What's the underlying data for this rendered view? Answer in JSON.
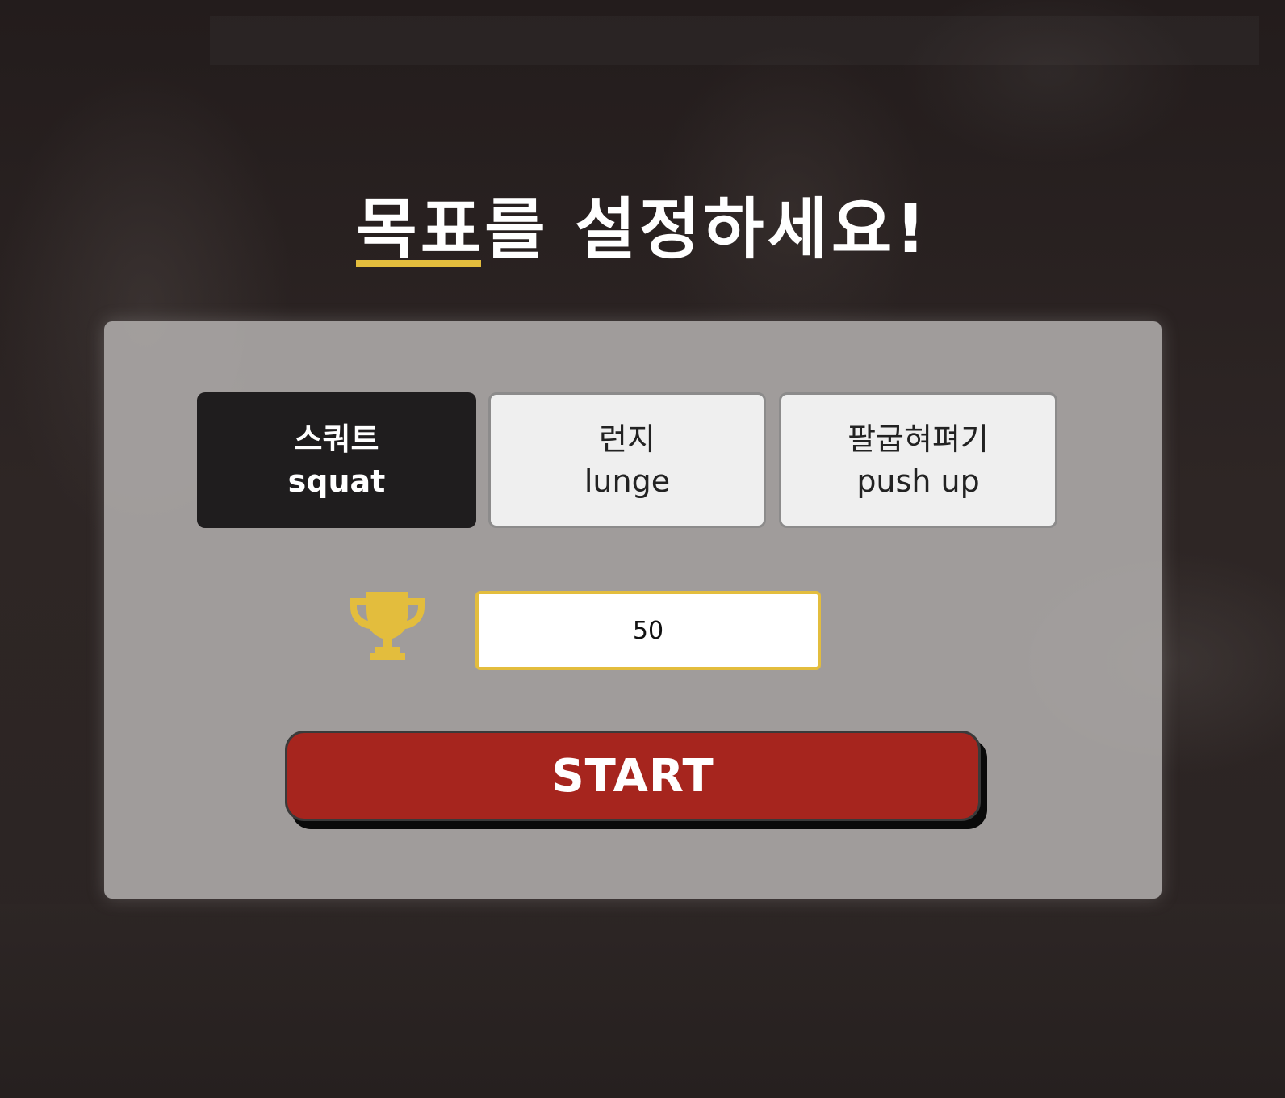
{
  "header": {
    "title_highlight": "목표",
    "title_rest": "를 설정하세요!"
  },
  "exercises": [
    {
      "korean": "스쿼트",
      "english": "squat",
      "selected": true
    },
    {
      "korean": "런지",
      "english": "lunge",
      "selected": false
    },
    {
      "korean": "팔굽혀펴기",
      "english": "push up",
      "selected": false
    }
  ],
  "goal": {
    "icon": "trophy-icon",
    "value": "50"
  },
  "start_label": "START",
  "colors": {
    "accent": "#e3bd3d",
    "start": "#a6251e",
    "selected_bg": "#1f1d1e",
    "unselected_bg": "#efefef"
  }
}
